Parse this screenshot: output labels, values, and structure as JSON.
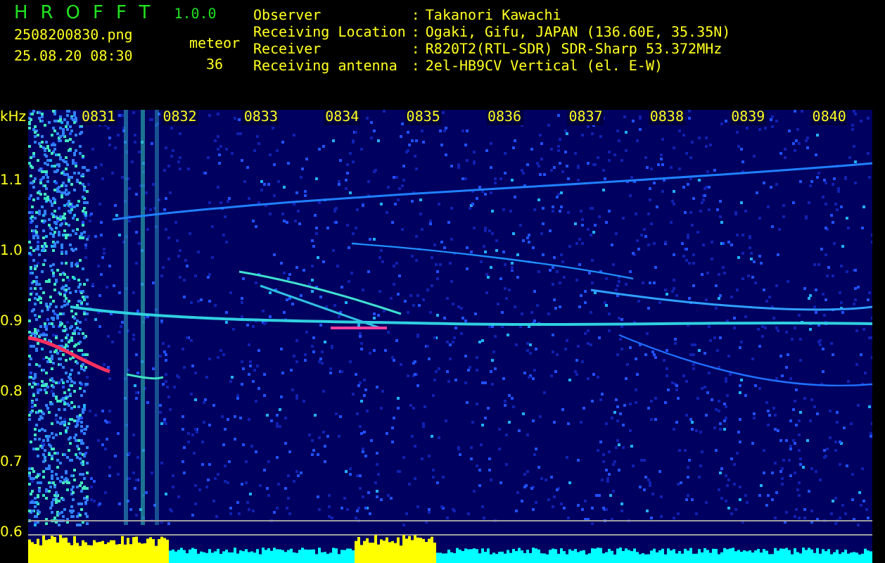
{
  "app": {
    "title": "HROFFT",
    "version": "1.0.0",
    "filename": "2508200830.png",
    "datetime": "25.08.20 08:30",
    "count_label": "meteor",
    "count": "36"
  },
  "info": [
    {
      "label": "Observer",
      "separator": ":",
      "value": "Takanori Kawachi"
    },
    {
      "label": "Receiving Location",
      "separator": ":",
      "value": "Ogaki, Gifu, JAPAN (136.60E, 35.35N)"
    },
    {
      "label": "Receiver",
      "separator": ":",
      "value": "R820T2(RTL-SDR) SDR-Sharp 53.372MHz"
    },
    {
      "label": "Receiving antenna",
      "separator": ":",
      "value": "2el-HB9CV Vertical (el. E-W)"
    }
  ],
  "spectrogram": {
    "y_unit": "kHz",
    "y_labels": [
      "1.1",
      "1.0",
      "0.9",
      "0.8",
      "0.7",
      "0.6"
    ],
    "x_labels": [
      "0831",
      "0832",
      "0833",
      "0834",
      "0835",
      "0836",
      "0837",
      "0838",
      "0839",
      "0840"
    ]
  }
}
